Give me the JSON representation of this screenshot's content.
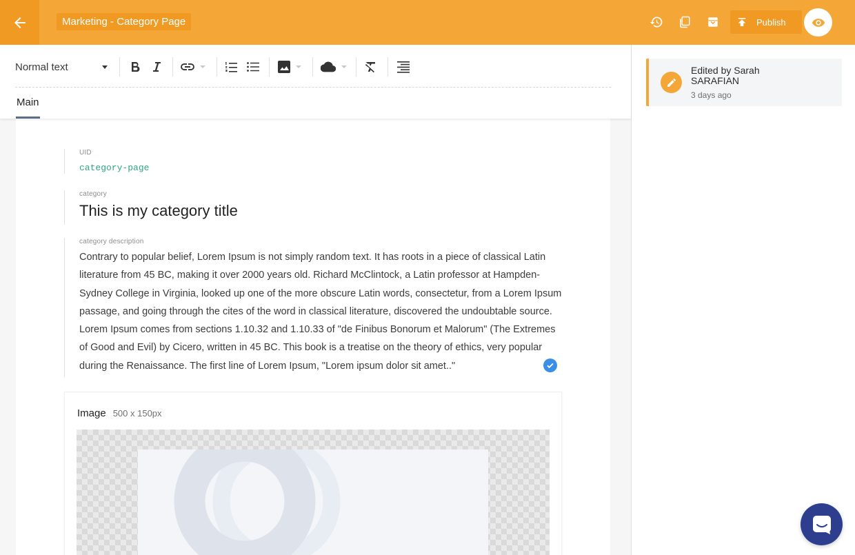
{
  "header": {
    "doc_title": "Marketing - Category Page",
    "publish_label": "Publish",
    "accent_color": "#f4a637"
  },
  "toolbar": {
    "text_style": "Normal text",
    "tab_main": "Main"
  },
  "document": {
    "uid_label": "UID",
    "uid_value": "category-page",
    "category_label": "category",
    "category_value": "This is my category title",
    "description_label": "category description",
    "description_value": "Contrary to popular belief, Lorem Ipsum is not simply random text. It has roots in a piece of classical Latin literature from 45 BC, making it over 2000 years old. Richard McClintock, a Latin professor at Hampden-Sydney College in Virginia, looked up one of the more obscure Latin words, consectetur, from a Lorem Ipsum passage, and going through the cites of the word in classical literature, discovered the undoubtable source. Lorem Ipsum comes from sections 1.10.32 and 1.10.33 of \"de Finibus Bonorum et Malorum\" (The Extremes of Good and Evil) by Cicero, written in 45 BC. This book is a treatise on the theory of ethics, very popular during the Renaissance. The first line of Lorem Ipsum, \"Lorem ipsum dolor sit amet..\"",
    "image_label": "Image",
    "image_size": "500 x 150px"
  },
  "sidebar": {
    "edited_by": "Edited by Sarah SARAFIAN",
    "edited_time": "3 days ago"
  },
  "icons": [
    "back-arrow-icon",
    "history-icon",
    "duplicate-icon",
    "archive-icon",
    "publish-upload-icon",
    "eye-icon",
    "bold-icon",
    "italic-icon",
    "link-icon",
    "ordered-list-icon",
    "bullet-list-icon",
    "image-icon",
    "cloud-embed-icon",
    "clear-format-icon",
    "align-right-icon",
    "pencil-icon",
    "check-icon",
    "chat-icon"
  ]
}
